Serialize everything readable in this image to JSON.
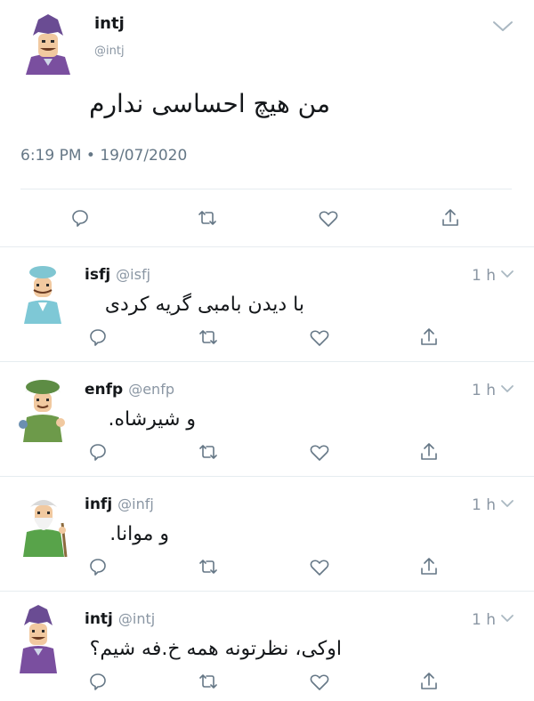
{
  "main_tweet": {
    "display_name": "intj",
    "handle": "@intj",
    "text": "من هیچ احساسی ندارم",
    "timestamp": "6:19 PM • 19/07/2020",
    "avatar_icon": "intj-character-avatar",
    "menu_icon": "chevron-down-icon"
  },
  "replies": [
    {
      "display_name": "isfj",
      "handle": "@isfj",
      "time": "1 h",
      "text": "با دیدن بامبی گریه کردی",
      "avatar_icon": "isfj-character-avatar"
    },
    {
      "display_name": "enfp",
      "handle": "@enfp",
      "time": "1 h",
      "text": "و شیرشاه.",
      "avatar_icon": "enfp-character-avatar"
    },
    {
      "display_name": "infj",
      "handle": "@infj",
      "time": "1 h",
      "text": "و موانا.",
      "avatar_icon": "infj-character-avatar"
    },
    {
      "display_name": "intj",
      "handle": "@intj",
      "time": "1 h",
      "text": "اوکی، نظرتونه همه خ.فه شیم؟",
      "avatar_icon": "intj-character-avatar"
    }
  ],
  "action_icons": [
    "reply-icon",
    "retweet-icon",
    "like-icon",
    "share-icon"
  ],
  "colors": {
    "text": "#14171a",
    "secondary": "#657786",
    "divider": "#e6ecf0"
  }
}
